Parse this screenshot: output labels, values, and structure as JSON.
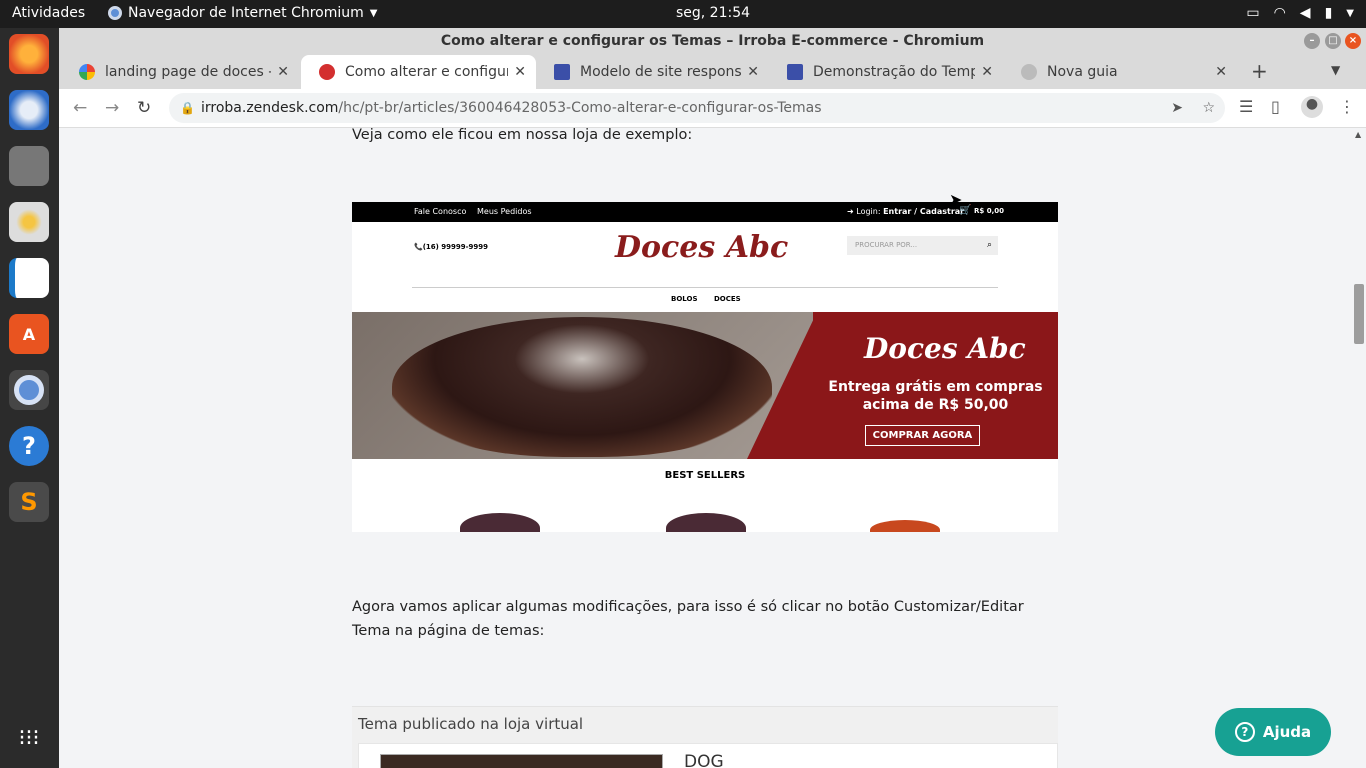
{
  "topbar": {
    "activities": "Atividades",
    "app": "Navegador de Internet Chromium",
    "clock": "seg, 21:54"
  },
  "dock": {
    "items": [
      "firefox-icon",
      "thunderbird-icon",
      "files-icon",
      "rhythmbox-icon",
      "writer-icon",
      "software-icon",
      "chromium-icon",
      "help-icon",
      "sublime-icon",
      "apps-grid-icon"
    ]
  },
  "window": {
    "title": "Como alterar e configurar os Temas – Irroba E-commerce - Chromium"
  },
  "tabs": [
    {
      "label": "landing page de doces - P"
    },
    {
      "label": "Como alterar e configura"
    },
    {
      "label": "Modelo de site responsiv"
    },
    {
      "label": "Demonstração do Templ"
    },
    {
      "label": "Nova guia"
    }
  ],
  "omnibox": {
    "host": "irroba.zendesk.com",
    "path": "/hc/pt-br/articles/360046428053-Como-alterar-e-configurar-os-Temas"
  },
  "article": {
    "p1": "Veja como ele ficou em nossa loja de exemplo:",
    "p2": "Agora vamos aplicar algumas modificações, para isso é só clicar no botão Customizar/Editar Tema na página de temas:"
  },
  "shop": {
    "topbar_left1": "Fale Conosco",
    "topbar_left2": "Meus Pedidos",
    "login_label": "Login:",
    "login_links": "Entrar / Cadastrar",
    "cart": "R$ 0,00",
    "phone": "(16) 99999-9999",
    "logo": "Doces Abc",
    "search_placeholder": "PROCURAR POR...",
    "menu1": "BOLOS",
    "menu2": "DOCES",
    "banner_logo": "Doces Abc",
    "banner_text": "Entrega grátis em compras acima de R$ 50,00",
    "banner_button": "COMPRAR AGORA",
    "bestsellers": "BEST SELLERS"
  },
  "panel": {
    "title": "Tema publicado na loja virtual",
    "theme_name": "DOG"
  },
  "help": {
    "label": "Ajuda"
  }
}
